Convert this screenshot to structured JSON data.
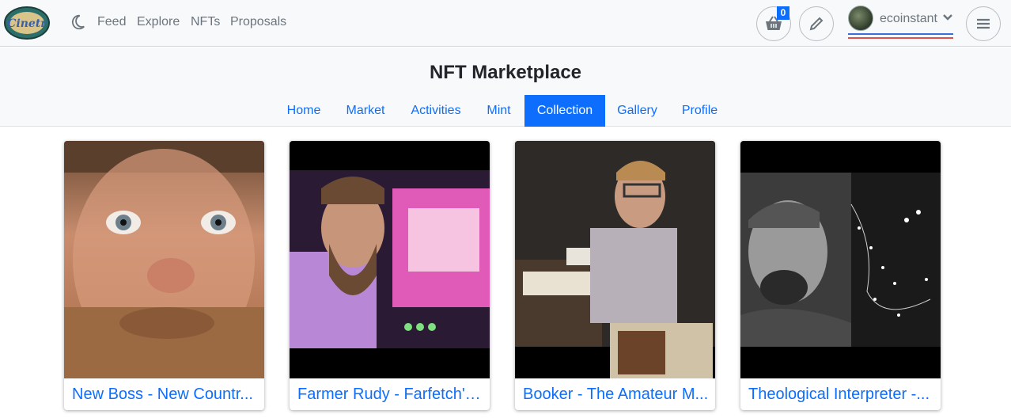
{
  "nav": {
    "links": [
      "Feed",
      "Explore",
      "NFTs",
      "Proposals"
    ],
    "cart_count": "0",
    "username": "ecoinstant"
  },
  "market": {
    "title": "NFT Marketplace",
    "tabs": [
      "Home",
      "Market",
      "Activities",
      "Mint",
      "Collection",
      "Gallery",
      "Profile"
    ],
    "active_tab": "Collection"
  },
  "cards": [
    {
      "title": "New Boss - New Countr..."
    },
    {
      "title": "Farmer Rudy - Farfetch'd..."
    },
    {
      "title": "Booker - The Amateur M..."
    },
    {
      "title": "Theological Interpreter -..."
    }
  ],
  "colors": {
    "accent": "#0d6efd",
    "navbar_bg": "#f8f9fa",
    "nav_text": "#6c757d"
  }
}
